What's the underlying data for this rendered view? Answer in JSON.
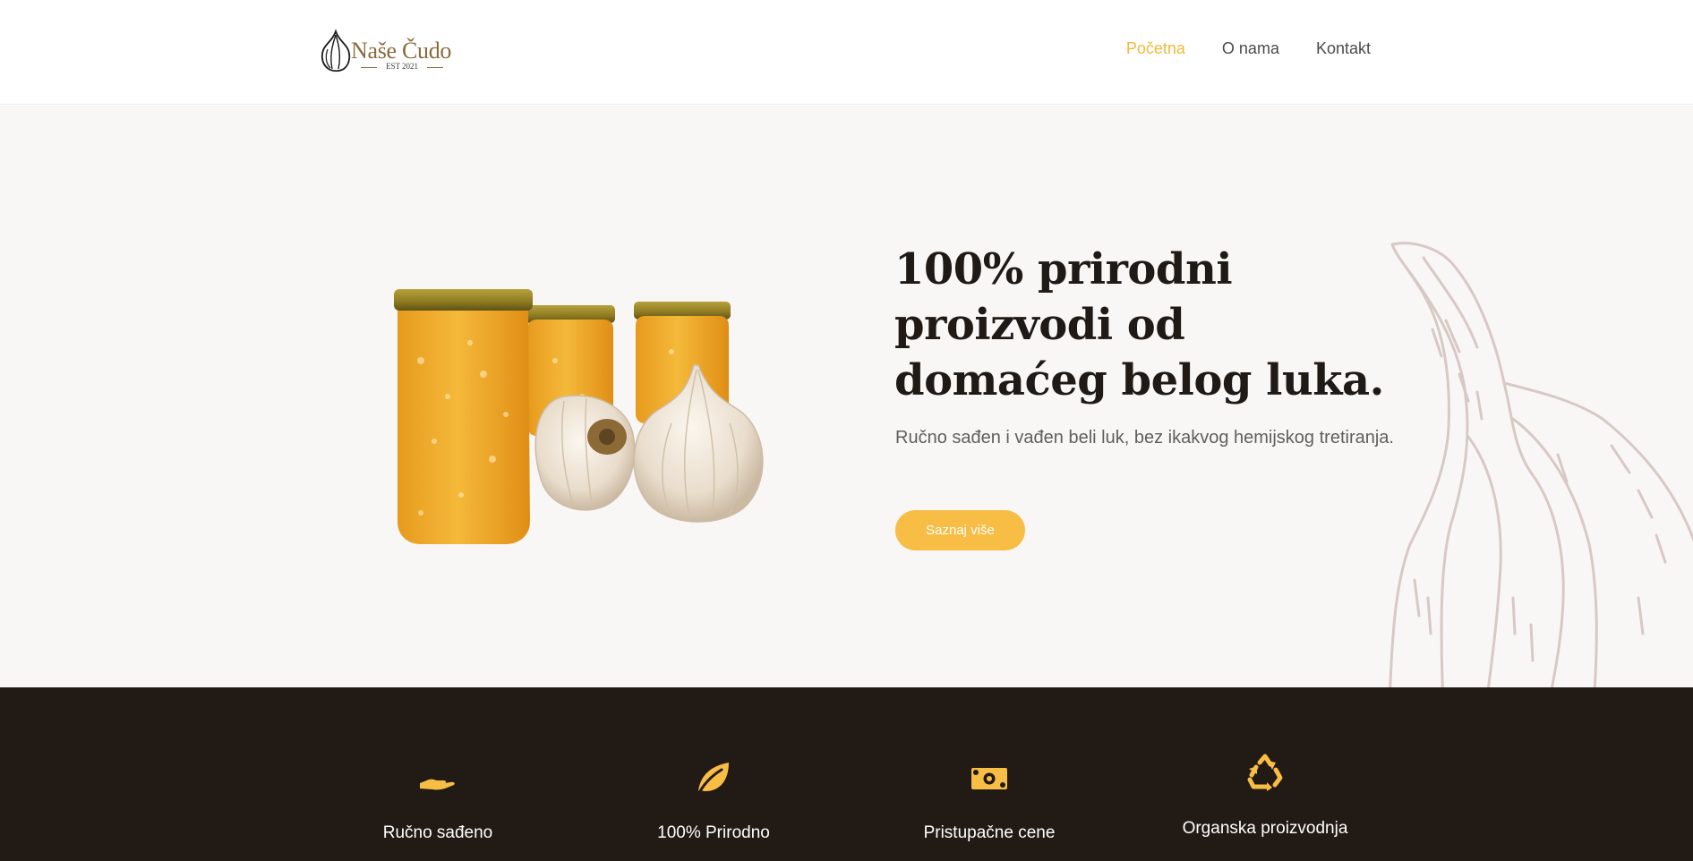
{
  "colors": {
    "accent": "#f7bd45",
    "nav_active": "#f2b93b",
    "dark_band": "#221a15",
    "hero_bg": "#f9f7f5",
    "logo_gold": "#8a6b3c"
  },
  "header": {
    "logo": {
      "name": "Naše Čudo",
      "subtitle": "EST 2021",
      "icon": "garlic-logo-icon"
    },
    "nav": [
      {
        "label": "Početna",
        "active": true
      },
      {
        "label": "O nama",
        "active": false
      },
      {
        "label": "Kontakt",
        "active": false
      }
    ]
  },
  "hero": {
    "title": "100% prirodni proizvodi od domaćeg belog luka.",
    "text": "Ručno sađen i vađen beli luk, bez ikakvog hemijskog tretiranja.",
    "cta_label": "Saznaj više",
    "image": "jars-and-garlic-image",
    "illustration": "garlic-sketch-illustration"
  },
  "features": [
    {
      "label": "Ručno sađeno",
      "icon": "hand-icon"
    },
    {
      "label": "100% Prirodno",
      "icon": "leaf-icon"
    },
    {
      "label": "Pristupačne cene",
      "icon": "money-icon"
    },
    {
      "label": "Organska proizvodnja",
      "icon": "recycle-icon"
    }
  ]
}
